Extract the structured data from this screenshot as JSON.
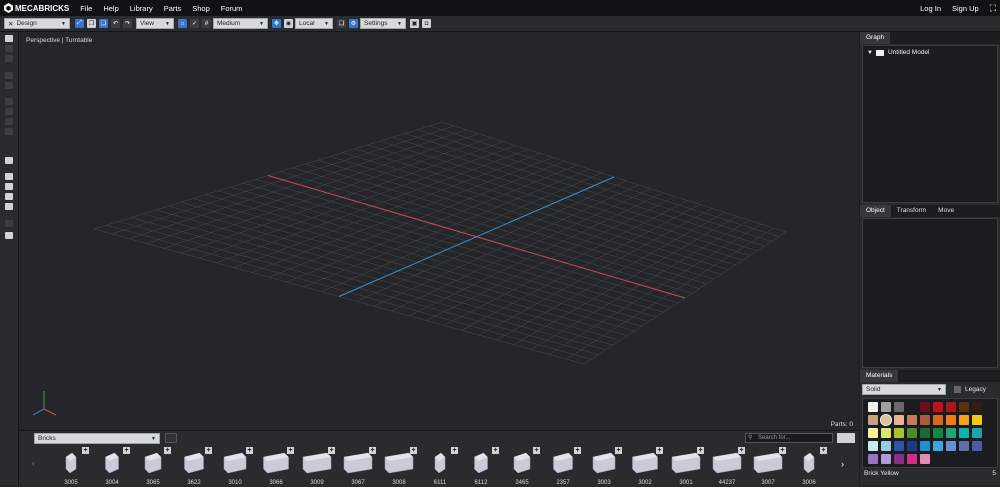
{
  "app": {
    "logo_text": "MECABRICKS"
  },
  "menu": [
    "File",
    "Help",
    "Library",
    "Parts",
    "Shop",
    "Forum"
  ],
  "auth": {
    "login": "Log In",
    "signup": "Sign Up"
  },
  "toolbar": {
    "mode": "Design",
    "view": "View",
    "grid_size": "Medium",
    "space": "Local",
    "settings": "Settings"
  },
  "viewport": {
    "label": "Perspective | Turntable",
    "parts_count": "Parts: 0"
  },
  "graph_panel": {
    "tab": "Graph",
    "model_name": "Untitled Model"
  },
  "object_panel": {
    "tabs": [
      "Object",
      "Transform",
      "Move"
    ]
  },
  "materials_panel": {
    "tab": "Materials",
    "material_type": "Solid",
    "legacy_label": "Legacy",
    "selected_color": "Brick Yellow",
    "selected_id": "5",
    "colors": [
      "#f2f2f2",
      "#a0a0a0",
      "#6b6b6b",
      "#1b1b1b",
      "#6d0e1a",
      "#c4101f",
      "#b01418",
      "#5e3012",
      "#351c12",
      "#c4a27b",
      "#ddc29a",
      "#e9b38e",
      "#c27a5b",
      "#a55d3a",
      "#d96a1d",
      "#f07a1a",
      "#f6a31c",
      "#f5c518",
      "#fff09a",
      "#d6e86a",
      "#a5c52b",
      "#4a8c2c",
      "#1e6a34",
      "#0d8a3e",
      "#23a37a",
      "#0ab5b0",
      "#1aa3b3",
      "#c7ecec",
      "#9bc9e8",
      "#2d52b0",
      "#1b3a8a",
      "#1e8fd0",
      "#3aa7e0",
      "#6a8fd5",
      "#5a72a8",
      "#4d5ba3",
      "#9b72c6",
      "#b39ad6",
      "#8a2e8a",
      "#d42b84",
      "#e98ab2"
    ]
  },
  "bricks_bar": {
    "category": "Bricks",
    "search_placeholder": "Search for...",
    "items": [
      "3005",
      "3004",
      "3065",
      "3622",
      "3010",
      "3066",
      "3009",
      "3067",
      "3008",
      "6111",
      "6112",
      "2465",
      "2357",
      "3003",
      "3002",
      "3001",
      "44237",
      "3007",
      "3006"
    ]
  }
}
